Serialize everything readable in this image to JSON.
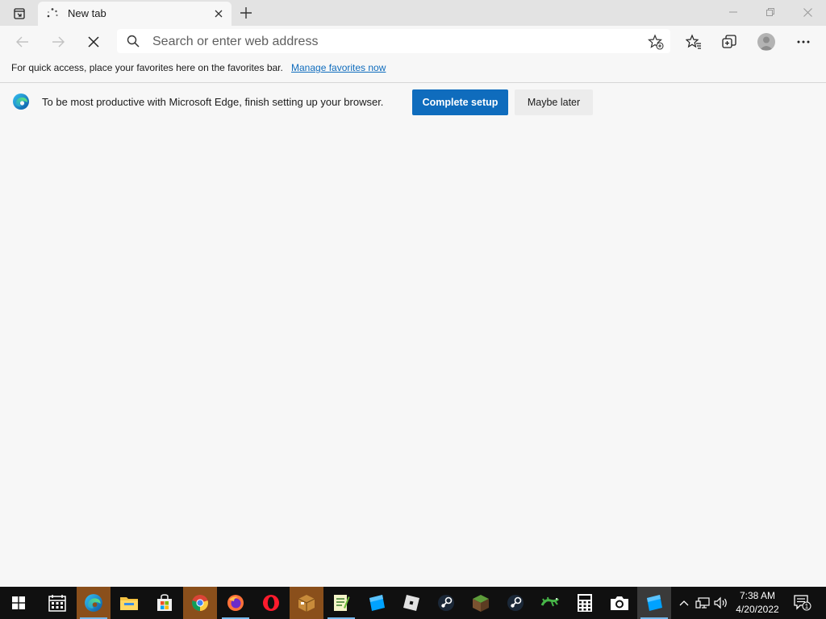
{
  "tab": {
    "title": "New tab"
  },
  "addressbar": {
    "placeholder": "Search or enter web address"
  },
  "favorites_bar": {
    "text": "For quick access, place your favorites here on the favorites bar.",
    "link": "Manage favorites now"
  },
  "banner": {
    "message": "To be most productive with Microsoft Edge, finish setting up your browser.",
    "primary_button": "Complete setup",
    "secondary_button": "Maybe later"
  },
  "taskbar": {
    "apps": [
      "start",
      "calendar",
      "edge",
      "file-explorer",
      "store",
      "chrome",
      "firefox",
      "opera",
      "package",
      "notepad-plus",
      "roblox-studio",
      "roblox",
      "steam",
      "minecraft",
      "steam",
      "green-app",
      "calculator",
      "camera",
      "roblox-studio"
    ],
    "clock_time": "7:38 AM",
    "clock_date": "4/20/2022",
    "notification_count": "1"
  },
  "colors": {
    "accent": "#0f6cbd",
    "titlebar": "#e3e3e3",
    "taskbar": "#101010"
  }
}
